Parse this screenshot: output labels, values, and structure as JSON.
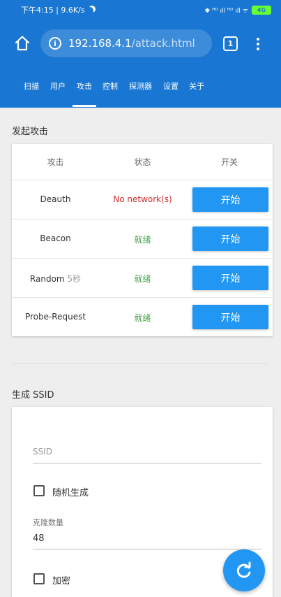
{
  "status_bar": {
    "time_speed": "下午4:15 | 9.6K/s",
    "signal_text": "✱ ᴴᴰ ıll ᴴᴰ ıll ᯤ",
    "battery_label": "4G"
  },
  "browser": {
    "url_host": "192.168.4.1",
    "url_path": "/attack.html",
    "tab_count": "1"
  },
  "nav": {
    "items": [
      "扫描",
      "用户",
      "攻击",
      "控制",
      "探测器",
      "设置",
      "关于"
    ],
    "active_index": 2
  },
  "attack_section": {
    "title": "发起攻击",
    "headers": {
      "attack": "攻击",
      "status": "状态",
      "toggle": "开关"
    },
    "rows": [
      {
        "name": "Deauth",
        "suffix": "",
        "status": "No network(s)",
        "status_color": "#d32f2f",
        "button": "开始"
      },
      {
        "name": "Beacon",
        "suffix": "",
        "status": "就绪",
        "status_color": "#43a047",
        "button": "开始"
      },
      {
        "name": "Random",
        "suffix": " 5秒",
        "status": "就绪",
        "status_color": "#43a047",
        "button": "开始"
      },
      {
        "name": "Probe-Request",
        "suffix": "",
        "status": "就绪",
        "status_color": "#43a047",
        "button": "开始"
      }
    ]
  },
  "ssid_section": {
    "title": "生成 SSID",
    "ssid_placeholder": "SSID",
    "random_label": "随机生成",
    "clone_label": "克隆数量",
    "clone_value": "48",
    "encrypt_label": "加密"
  },
  "colors": {
    "primary": "#1976d2",
    "button": "#2196f3",
    "status_error": "#d32f2f",
    "status_ready": "#43a047"
  },
  "icons": {
    "home": "home-icon",
    "info": "info-icon",
    "tabs": "tab-count-icon",
    "menu": "more-vert-icon",
    "fab": "refresh-icon"
  }
}
